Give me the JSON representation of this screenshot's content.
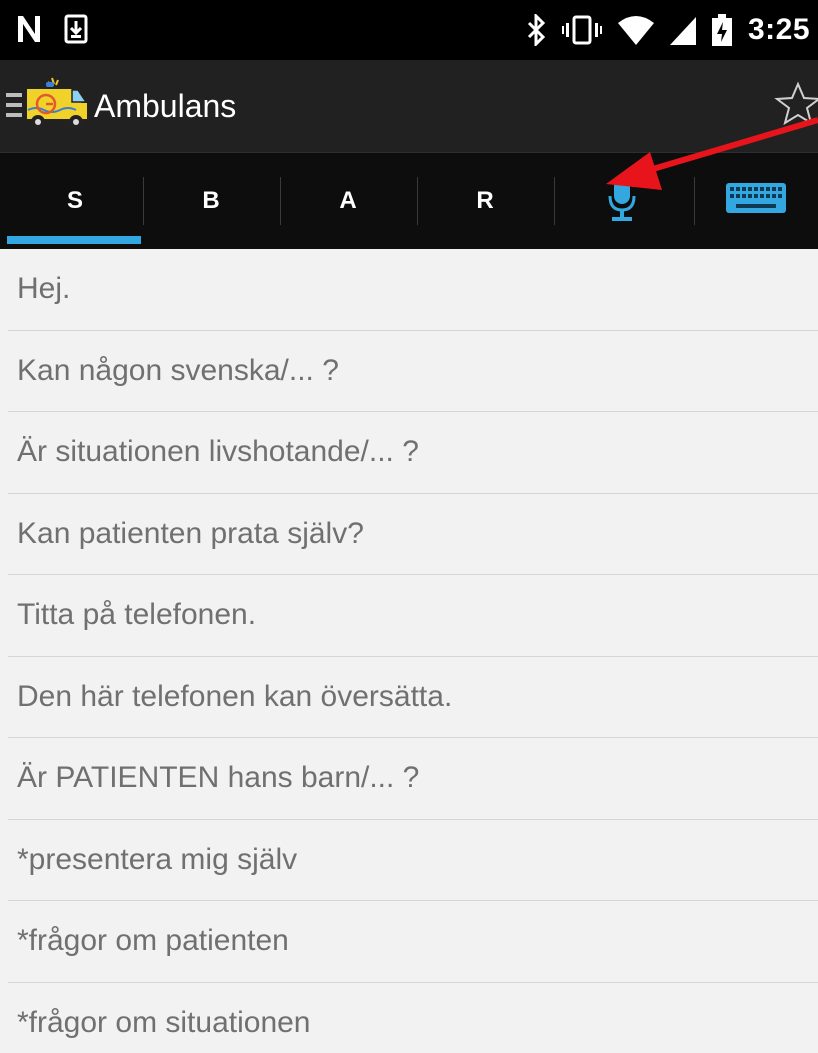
{
  "status_bar": {
    "time": "3:25",
    "icons": [
      "nfc-icon",
      "download-icon",
      "bluetooth-icon",
      "vibrate-icon",
      "wifi-icon",
      "cell-signal-icon",
      "battery-icon"
    ]
  },
  "app_bar": {
    "title": "Ambulans",
    "icons": [
      "drawer-icon",
      "ambulance-logo-icon",
      "star-icon"
    ]
  },
  "tabs": [
    {
      "label": "S",
      "selected": true
    },
    {
      "label": "B",
      "selected": false
    },
    {
      "label": "A",
      "selected": false
    },
    {
      "label": "R",
      "selected": false
    },
    {
      "label": "",
      "icon": "microphone-icon",
      "selected": false
    },
    {
      "label": "",
      "icon": "keyboard-icon",
      "selected": false
    }
  ],
  "phrases": [
    "Hej.",
    "Kan någon svenska/... ?",
    "Är situationen livshotande/... ?",
    "Kan patienten prata själv?",
    "Titta på telefonen.",
    "Den här telefonen kan översätta.",
    "Är PATIENTEN hans barn/... ?",
    "*presentera mig själv",
    "*frågor om patienten",
    "*frågor om situationen"
  ],
  "colors": {
    "accent": "#33a8e0",
    "annotation_arrow": "#e8141b",
    "list_text": "#707070",
    "list_background": "#f2f2f2"
  }
}
